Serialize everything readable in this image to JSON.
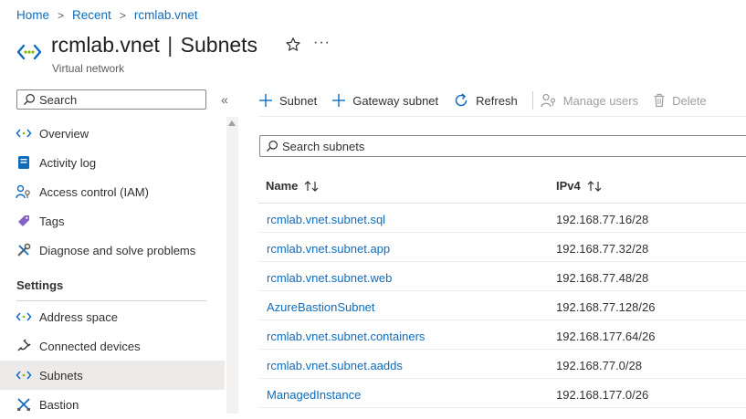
{
  "breadcrumb": [
    {
      "label": "Home"
    },
    {
      "label": "Recent"
    },
    {
      "label": "rcmlab.vnet"
    }
  ],
  "header": {
    "resource_name": "rcmlab.vnet",
    "separator": "|",
    "page_name": "Subnets",
    "subtitle": "Virtual network",
    "favorite_icon": "star-icon",
    "more_glyph": "···"
  },
  "nav": {
    "search_placeholder": "Search",
    "collapse_glyph": "«",
    "items_top": [
      {
        "label": "Overview",
        "icon": "vnet-icon"
      },
      {
        "label": "Activity log",
        "icon": "activity-log-icon"
      },
      {
        "label": "Access control (IAM)",
        "icon": "iam-icon"
      },
      {
        "label": "Tags",
        "icon": "tag-icon"
      },
      {
        "label": "Diagnose and solve problems",
        "icon": "wrench-icon"
      }
    ],
    "section_settings": "Settings",
    "items_settings": [
      {
        "label": "Address space",
        "icon": "vnet-icon"
      },
      {
        "label": "Connected devices",
        "icon": "plug-icon"
      },
      {
        "label": "Subnets",
        "icon": "vnet-icon",
        "selected": true
      },
      {
        "label": "Bastion",
        "icon": "bastion-icon"
      }
    ]
  },
  "toolbar": {
    "add_subnet": "Subnet",
    "add_gateway_subnet": "Gateway subnet",
    "refresh": "Refresh",
    "manage_users": "Manage users",
    "delete": "Delete"
  },
  "subnets": {
    "search_placeholder": "Search subnets",
    "columns": {
      "name": "Name",
      "ipv4": "IPv4"
    },
    "rows": [
      {
        "name": "rcmlab.vnet.subnet.sql",
        "ipv4": "192.168.77.16/28"
      },
      {
        "name": "rcmlab.vnet.subnet.app",
        "ipv4": "192.168.77.32/28"
      },
      {
        "name": "rcmlab.vnet.subnet.web",
        "ipv4": "192.168.77.48/28"
      },
      {
        "name": "AzureBastionSubnet",
        "ipv4": "192.168.77.128/26"
      },
      {
        "name": "rcmlab.vnet.subnet.containers",
        "ipv4": "192.168.177.64/26"
      },
      {
        "name": "rcmlab.vnet.subnet.aadds",
        "ipv4": "192.168.77.0/28"
      },
      {
        "name": "ManagedInstance",
        "ipv4": "192.168.177.0/26"
      }
    ]
  },
  "colors": {
    "accent": "#0f6cbd",
    "selected_bg": "#edebe9",
    "disabled": "#a19f9d"
  }
}
